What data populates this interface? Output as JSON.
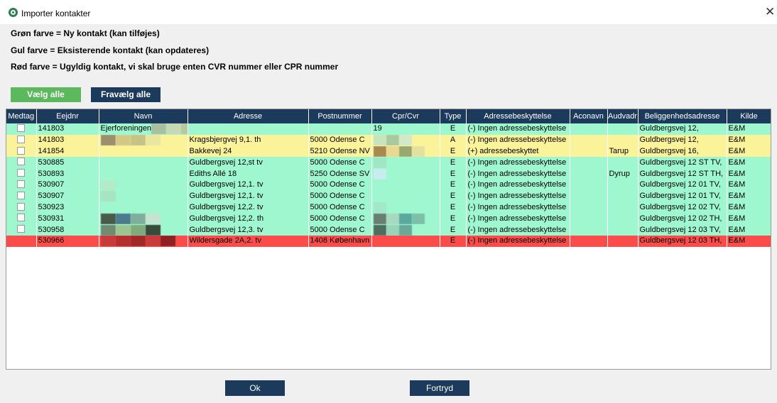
{
  "window": {
    "title": "Importer kontakter"
  },
  "legend": {
    "green": "Grøn farve = Ny kontakt (kan tilføjes)",
    "yellow": "Gul farve = Eksisterende kontakt (kan opdateres)",
    "red": "Rød farve = Ugyldig kontakt, vi skal bruge enten CVR nummer eller CPR nummer"
  },
  "buttons": {
    "select_all": "Vælg alle",
    "deselect_all": "Fravælg alle",
    "ok": "Ok",
    "cancel": "Fortryd"
  },
  "table": {
    "columns": [
      "Medtag",
      "Eejdnr",
      "Navn",
      "Adresse",
      "Postnummer",
      "Cpr/Cvr",
      "Type",
      "Adressebeskyttelse",
      "Aconavn",
      "Audvadr",
      "Beliggenhedsadresse",
      "Kilde"
    ],
    "rows": [
      {
        "status": "new",
        "checked": true,
        "ejdnr": "141803",
        "navn": "Ejerforeningen",
        "adresse": "",
        "postnummer": "",
        "cpr": "19",
        "type": "E",
        "beskyttelse": "(-) Ingen adressebeskyttelse",
        "aconavn": "",
        "audvadr": "",
        "belig": "Guldbergsvej 12,",
        "kilde": "E&M"
      },
      {
        "status": "exist",
        "checked": true,
        "ejdnr": "141803",
        "navn": "",
        "adresse": "Kragsbjergvej 9,1. th",
        "postnummer": "5000 Odense C",
        "cpr": "",
        "type": "A",
        "beskyttelse": "(-) Ingen adressebeskyttelse",
        "aconavn": "",
        "audvadr": "",
        "belig": "Guldbergsvej 12,",
        "kilde": "E&M"
      },
      {
        "status": "exist",
        "checked": true,
        "ejdnr": "141854",
        "navn": "",
        "adresse": "Bakkevej 24",
        "postnummer": "5210 Odense NV",
        "cpr": "",
        "type": "E",
        "beskyttelse": "(+) adressebeskyttet",
        "aconavn": "",
        "audvadr": "Tarup",
        "belig": "Guldbergsvej 16,",
        "kilde": "E&M"
      },
      {
        "status": "new",
        "checked": true,
        "ejdnr": "530885",
        "navn": "",
        "adresse": "Guldbergsvej 12,st tv",
        "postnummer": "5000 Odense C",
        "cpr": "",
        "type": "E",
        "beskyttelse": "(-) Ingen adressebeskyttelse",
        "aconavn": "",
        "audvadr": "",
        "belig": "Guldbergsvej 12 ST TV,",
        "kilde": "E&M"
      },
      {
        "status": "new",
        "checked": true,
        "ejdnr": "530893",
        "navn": "",
        "adresse": "Ediths Allé 18",
        "postnummer": "5250 Odense SV",
        "cpr": "",
        "type": "E",
        "beskyttelse": "(-) Ingen adressebeskyttelse",
        "aconavn": "",
        "audvadr": "Dyrup",
        "belig": "Guldbergsvej 12 ST TH,",
        "kilde": "E&M"
      },
      {
        "status": "new",
        "checked": true,
        "ejdnr": "530907",
        "navn": "",
        "adresse": "Guldbergsvej 12,1. tv",
        "postnummer": "5000 Odense C",
        "cpr": "",
        "type": "E",
        "beskyttelse": "(-) Ingen adressebeskyttelse",
        "aconavn": "",
        "audvadr": "",
        "belig": "Guldbergsvej 12 01 TV,",
        "kilde": "E&M"
      },
      {
        "status": "new",
        "checked": true,
        "ejdnr": "530907",
        "navn": "",
        "adresse": "Guldbergsvej 12,1. tv",
        "postnummer": "5000 Odense C",
        "cpr": "",
        "type": "E",
        "beskyttelse": "(-) Ingen adressebeskyttelse",
        "aconavn": "",
        "audvadr": "",
        "belig": "Guldbergsvej 12 01 TV,",
        "kilde": "E&M"
      },
      {
        "status": "new",
        "checked": true,
        "ejdnr": "530923",
        "navn": "",
        "adresse": "Guldbergsvej 12,2. tv",
        "postnummer": "5000 Odense C",
        "cpr": "",
        "type": "E",
        "beskyttelse": "(-) Ingen adressebeskyttelse",
        "aconavn": "",
        "audvadr": "",
        "belig": "Guldbergsvej 12 02 TV,",
        "kilde": "E&M"
      },
      {
        "status": "new",
        "checked": true,
        "ejdnr": "530931",
        "navn": "",
        "adresse": "Guldbergsvej 12,2. th",
        "postnummer": "5000 Odense C",
        "cpr": "",
        "type": "E",
        "beskyttelse": "(-) Ingen adressebeskyttelse",
        "aconavn": "",
        "audvadr": "",
        "belig": "Guldbergsvej 12 02 TH,",
        "kilde": "E&M"
      },
      {
        "status": "new",
        "checked": true,
        "ejdnr": "530958",
        "navn": "",
        "adresse": "Guldbergsvej 12,3. tv",
        "postnummer": "5000 Odense C",
        "cpr": "",
        "type": "E",
        "beskyttelse": "(-) Ingen adressebeskyttelse",
        "aconavn": "",
        "audvadr": "",
        "belig": "Guldbergsvej 12 03 TV,",
        "kilde": "E&M"
      },
      {
        "status": "invalid",
        "checked": false,
        "ejdnr": "530966",
        "navn": "",
        "adresse": "Wildersgade 2A,2. tv",
        "postnummer": "1408 København K",
        "cpr": "",
        "type": "E",
        "beskyttelse": "(-) Ingen adressebeskyttelse",
        "aconavn": "",
        "audvadr": "",
        "belig": "Guldbergsvej 12 03 TH,",
        "kilde": "E&M"
      }
    ]
  }
}
